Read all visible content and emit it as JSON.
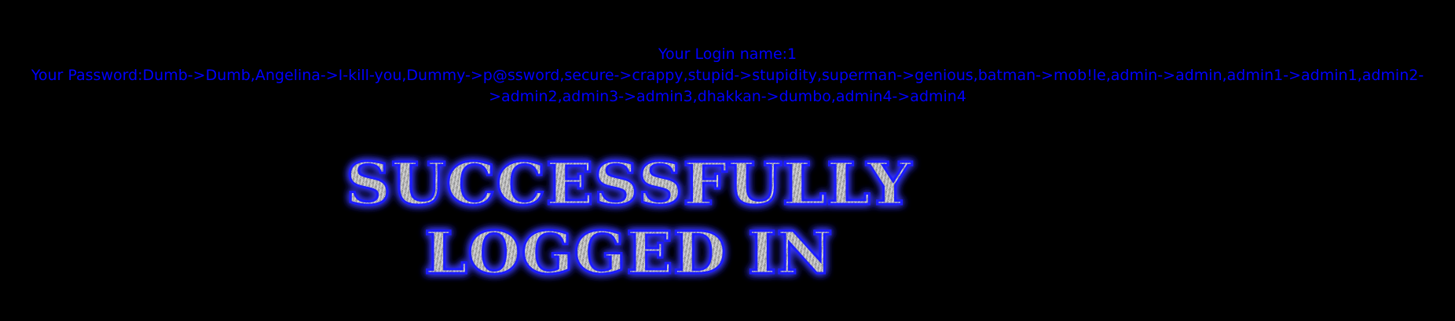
{
  "login": {
    "name_label": "Your Login name:",
    "name_value": "1",
    "password_label": "Your Password:",
    "password_value": "Dumb->Dumb,Angelina->I-kill-you,Dummy->p@ssword,secure->crappy,stupid->stupidity,superman->genious,batman->mob!le,admin->admin,admin1->admin1,admin2->admin2,admin3->admin3,dhakkan->dumbo,admin4->admin4"
  },
  "banner": {
    "line1": "SUCCESSFULLY",
    "line2": "LOGGED IN"
  },
  "colors": {
    "background": "#000000",
    "info_text": "#0000ff",
    "banner_glow": "#3a3aff",
    "banner_metal_light": "#e6e6e6",
    "banner_metal_dark": "#7a7a7a"
  }
}
